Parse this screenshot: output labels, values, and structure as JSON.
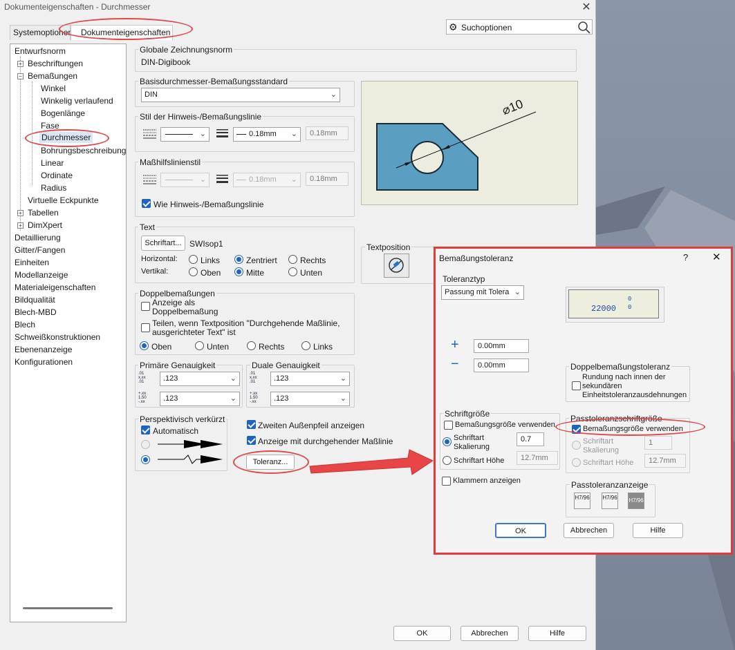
{
  "window": {
    "title": "Dokumenteigenschaften - Durchmesser"
  },
  "tabs": [
    "Systemoptionen",
    "Dokumenteigenschaften"
  ],
  "search": {
    "label": "Suchoptionen"
  },
  "tree": {
    "items": [
      "Entwurfsnorm",
      "Beschriftungen",
      "Bemaßungen",
      "Winkel",
      "Winkelig verlaufend",
      "Bogenlänge",
      "Fase",
      "Durchmesser",
      "Bohrungsbeschreibung",
      "Linear",
      "Ordinate",
      "Radius",
      "Virtuelle Eckpunkte",
      "Tabellen",
      "DimXpert",
      "Detaillierung",
      "Gitter/Fangen",
      "Einheiten",
      "Modellanzeige",
      "Materialeigenschaften",
      "Bildqualität",
      "Blech-MBD",
      "Blech",
      "Schweißkonstruktionen",
      "Ebenenanzeige",
      "Konfigurationen"
    ],
    "selected": "Durchmesser"
  },
  "global_standard": {
    "label": "Globale Zeichnungsnorm",
    "value": "DIN-Digibook"
  },
  "base_standard": {
    "label": "Basisdurchmesser-Bemaßungsstandard",
    "value": "DIN"
  },
  "leader_style": {
    "label": "Stil der Hinweis-/Bemaßungslinie",
    "thickness": "0.18mm",
    "custom": "0.18mm"
  },
  "extension_style": {
    "label": "Maßhilfslinienstil",
    "thickness": "0.18mm",
    "custom": "0.18mm",
    "same_label": "Wie Hinweis-/Bemaßungslinie"
  },
  "preview": {
    "dim_text": "⌀10"
  },
  "text": {
    "label": "Text",
    "font_button": "Schriftart...",
    "font_name": "SWIsop1",
    "horizontal_label": "Horizontal:",
    "vertical_label": "Vertikal:",
    "h_options": [
      "Links",
      "Zentriert",
      "Rechts"
    ],
    "v_options": [
      "Oben",
      "Mitte",
      "Unten"
    ]
  },
  "text_position": {
    "label": "Textposition"
  },
  "dual": {
    "label": "Doppelbemaßungen",
    "show": "Anzeige als Doppelbemaßung",
    "split": "Teilen, wenn Textposition \"Durchgehende Maßlinie, ausgerichteter Text\" ist",
    "positions": [
      "Oben",
      "Unten",
      "Rechts",
      "Links"
    ]
  },
  "primary_precision": {
    "label": "Primäre Genauigkeit",
    "value1": ".123",
    "value2": ".123"
  },
  "dual_precision": {
    "label": "Duale Genauigkeit",
    "value1": ".123",
    "value2": ".123"
  },
  "perspective": {
    "label": "Perspektivisch verkürzt",
    "auto": "Automatisch"
  },
  "options": {
    "second_arrow": "Zweiten Außenpfeil anzeigen",
    "solid_leader": "Anzeige mit durchgehender Maßlinie"
  },
  "tolerance_button": "Toleranz...",
  "footer": {
    "ok": "OK",
    "cancel": "Abbrechen",
    "help": "Hilfe"
  },
  "tol_dialog": {
    "title": "Bemaßungstoleranz",
    "help_q": "?",
    "type_label": "Toleranztyp",
    "type_value": "Passung mit Tolera",
    "preview_value": "22000",
    "preview_sup": "0",
    "preview_sub": "0",
    "plus": "+",
    "minus": "−",
    "upper": "0.00mm",
    "lower": "0.00mm",
    "dual_tol_label": "Doppelbemaßungstoleranz",
    "dual_tol_option": "Rundung nach innen der sekundären Einheitstoleranzausdehnungen",
    "font_group": "Schriftgröße",
    "use_dim_size": "Bemaßungsgröße verwenden",
    "font_scale": "Schriftart Skalierung",
    "scale_value": "0.7",
    "font_height": "Schriftart Höhe",
    "height_value": "12.7mm",
    "fit_group": "Passtoleranzschriftgröße",
    "fit_use_dim": "Bemaßungsgröße verwenden",
    "fit_scale": "Schriftart Skalierung",
    "fit_scale_value": "1",
    "fit_height": "Schriftart Höhe",
    "fit_height_value": "12.7mm",
    "brackets": "Klammern anzeigen",
    "fit_display": "Passtoleranzanzeige",
    "fit_icons": [
      "H7/96",
      "H7/96",
      "H7/96"
    ],
    "ok": "OK",
    "cancel": "Abbrechen",
    "help": "Hilfe"
  },
  "colors": {
    "accent": "#1d62c4",
    "highlight": "#e04848",
    "part_fill": "#5a9ec2"
  }
}
